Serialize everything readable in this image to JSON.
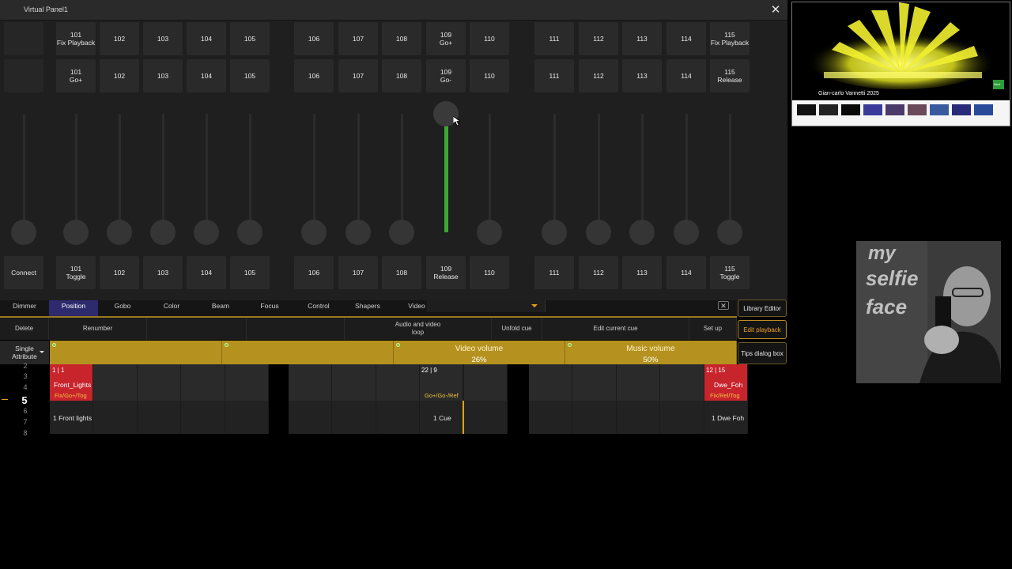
{
  "window": {
    "title": "Virtual Panel1",
    "close_glyph": "✕"
  },
  "top_row": [
    {
      "l1": "",
      "l2": ""
    },
    {
      "l1": "101",
      "l2": "Fix Playback"
    },
    {
      "l1": "102",
      "l2": ""
    },
    {
      "l1": "103",
      "l2": ""
    },
    {
      "l1": "104",
      "l2": ""
    },
    {
      "l1": "105",
      "l2": ""
    },
    {
      "l1": "106",
      "l2": ""
    },
    {
      "l1": "107",
      "l2": ""
    },
    {
      "l1": "108",
      "l2": ""
    },
    {
      "l1": "109",
      "l2": "Go+"
    },
    {
      "l1": "110",
      "l2": ""
    },
    {
      "l1": "111",
      "l2": ""
    },
    {
      "l1": "112",
      "l2": ""
    },
    {
      "l1": "113",
      "l2": ""
    },
    {
      "l1": "114",
      "l2": ""
    },
    {
      "l1": "115",
      "l2": "Fix Playback"
    }
  ],
  "mid_row": [
    {
      "l1": "",
      "l2": ""
    },
    {
      "l1": "101",
      "l2": "Go+"
    },
    {
      "l1": "102",
      "l2": ""
    },
    {
      "l1": "103",
      "l2": ""
    },
    {
      "l1": "104",
      "l2": ""
    },
    {
      "l1": "105",
      "l2": ""
    },
    {
      "l1": "106",
      "l2": ""
    },
    {
      "l1": "107",
      "l2": ""
    },
    {
      "l1": "108",
      "l2": ""
    },
    {
      "l1": "109",
      "l2": "Go-"
    },
    {
      "l1": "110",
      "l2": ""
    },
    {
      "l1": "111",
      "l2": ""
    },
    {
      "l1": "112",
      "l2": ""
    },
    {
      "l1": "113",
      "l2": ""
    },
    {
      "l1": "114",
      "l2": ""
    },
    {
      "l1": "115",
      "l2": "Release"
    }
  ],
  "bottom_row": [
    {
      "l1": "Connect",
      "l2": ""
    },
    {
      "l1": "101",
      "l2": "Toggle"
    },
    {
      "l1": "102",
      "l2": ""
    },
    {
      "l1": "103",
      "l2": ""
    },
    {
      "l1": "104",
      "l2": ""
    },
    {
      "l1": "105",
      "l2": ""
    },
    {
      "l1": "106",
      "l2": ""
    },
    {
      "l1": "107",
      "l2": ""
    },
    {
      "l1": "108",
      "l2": ""
    },
    {
      "l1": "109",
      "l2": "Release"
    },
    {
      "l1": "110",
      "l2": ""
    },
    {
      "l1": "111",
      "l2": ""
    },
    {
      "l1": "112",
      "l2": ""
    },
    {
      "l1": "113",
      "l2": ""
    },
    {
      "l1": "114",
      "l2": ""
    },
    {
      "l1": "115",
      "l2": "Toggle"
    }
  ],
  "fader_levels": [
    0,
    0,
    0,
    0,
    0,
    0,
    0,
    0,
    0,
    1.0,
    0,
    0,
    0,
    0,
    0,
    0
  ],
  "categories": [
    "Dimmer",
    "Position",
    "Gobo",
    "Color",
    "Beam",
    "Focus",
    "Control",
    "Shapers",
    "Video"
  ],
  "active_category": "Position",
  "side_buttons": [
    "Library Editor",
    "Edit playback",
    "Tips dialog box"
  ],
  "functions": [
    "Delete",
    "Renumber",
    "",
    "",
    "Audio and video loop",
    "Unfold cue",
    "Edit current cue",
    "Set up"
  ],
  "single_attribute": "Single Attribute",
  "gold_bars": [
    {
      "label": "",
      "value": ""
    },
    {
      "label": "",
      "value": ""
    },
    {
      "label": "Video volume",
      "value": "26%"
    },
    {
      "label": "Music volume",
      "value": "50%"
    }
  ],
  "pages": [
    "2",
    "3",
    "4",
    "5",
    "6",
    "7",
    "8"
  ],
  "current_page": "5",
  "executors": {
    "front": {
      "num": "1 | 1",
      "name": "Front_Lights",
      "fn": "Fix/Go+/Tog",
      "cue": "1 Front lights"
    },
    "mid": {
      "num": "22 | 9",
      "name": "",
      "fn": "Go+/Go-/Ref",
      "cue": "1 Cue"
    },
    "foh": {
      "num": "12 | 15",
      "name": "Dwe_Foh",
      "fn": "Fix/Rel/Tog",
      "cue": "1 Dwe Foh"
    }
  },
  "thumbnail": {
    "title": "Gian-carlo Vannetti 2025",
    "badge": "Next"
  },
  "webcam_text": [
    "my",
    "selfie",
    "face"
  ],
  "colors": {
    "accent_gold": "#b5921f",
    "fader_green": "#3aa832",
    "exec_red": "#c8242c",
    "active_tab": "#2d2a6e"
  }
}
